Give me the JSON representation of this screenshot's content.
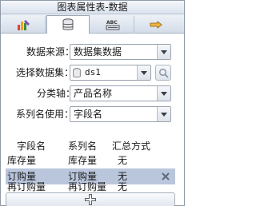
{
  "window": {
    "title": "图表属性表-数据"
  },
  "tabs": [
    {
      "icon": "chart-style-icon"
    },
    {
      "icon": "database-icon",
      "active": true
    },
    {
      "icon": "text-abc-icon"
    },
    {
      "icon": "hand-pointer-icon"
    }
  ],
  "form": {
    "data_source": {
      "label": "数据来源：",
      "value": "数据集数据"
    },
    "dataset": {
      "label": "选择数据集：",
      "value": "ds1"
    },
    "category_axis": {
      "label": "分类轴：",
      "value": "产品名称"
    },
    "series_name_use": {
      "label": "系列名使用：",
      "value": "字段名"
    }
  },
  "grid": {
    "columns": [
      "字段名",
      "系列名",
      "汇总方式"
    ],
    "rows": [
      {
        "field": "库存量",
        "series": "库存量",
        "agg": "无",
        "selected": false
      },
      {
        "field": "订购量",
        "series": "订购量",
        "agg": "无",
        "selected": true
      },
      {
        "field": "再订购量",
        "series": "再订购量",
        "agg": "无",
        "selected": false
      }
    ]
  },
  "colors": {
    "selected_row": "#b9c6dc",
    "accent": "#d9453a"
  }
}
